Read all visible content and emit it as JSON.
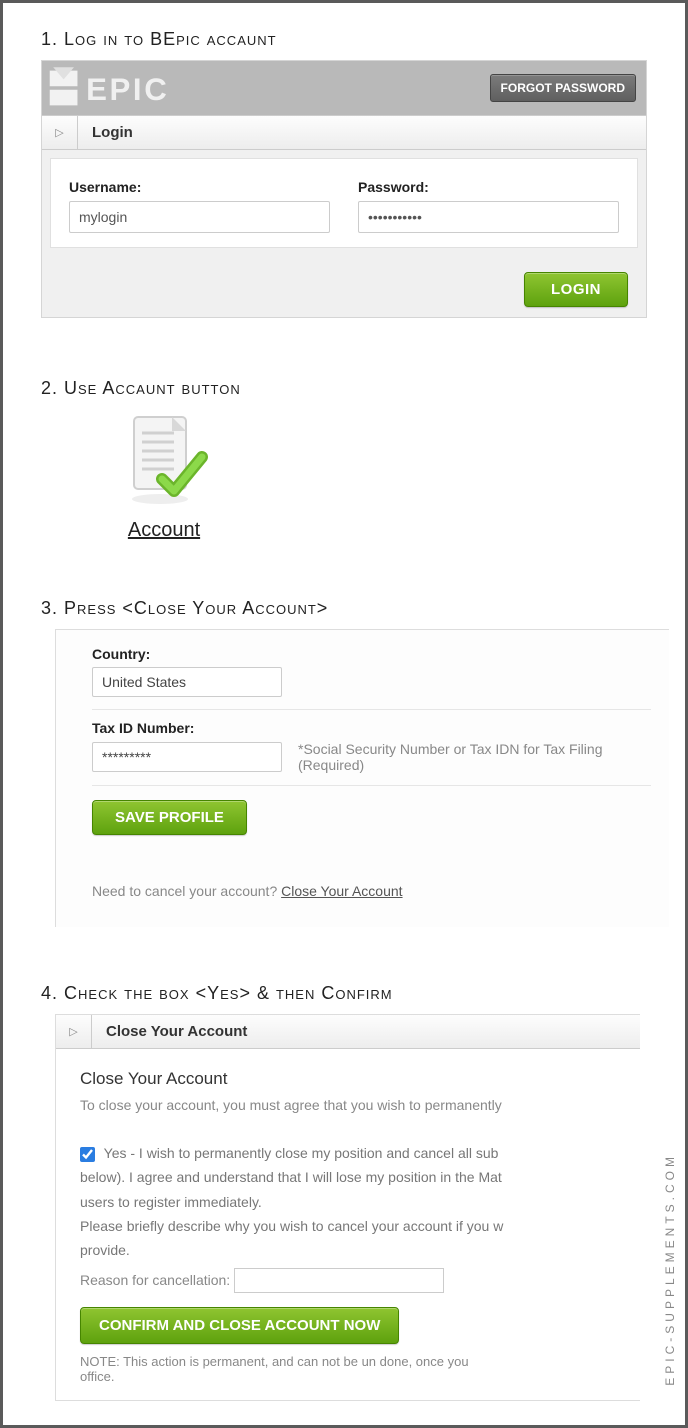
{
  "watermark": "EPIC-SUPPLEMENTS.COM",
  "step1": {
    "title": "1. Log in to BEpic accaunt",
    "forgot": "FORGOT PASSWORD",
    "tab": "Login",
    "username_label": "Username:",
    "username_value": "mylogin",
    "password_label": "Password:",
    "password_value": "•••••••••••",
    "login_btn": "LOGIN"
  },
  "step2": {
    "title": "2. Use Accaunt button",
    "link": "Account"
  },
  "step3": {
    "title": "3. Press <Close Your Account>",
    "country_label": "Country:",
    "country_value": "United States",
    "tax_label": "Tax ID Number:",
    "tax_value": "*********",
    "tax_hint": "*Social Security Number or Tax IDN for Tax Filing (Required)",
    "save_btn": "SAVE PROFILE",
    "cancel_question": "Need to cancel your account? ",
    "cancel_link": "Close Your Account"
  },
  "step4": {
    "title": "4. Check the box <Yes> & then Confirm",
    "tab": "Close Your Account",
    "heading": "Close Your Account",
    "lead": "To close your account, you must agree that you wish to permanently",
    "yes_text": "Yes - I wish to permanently close my position and cancel all sub",
    "yes_line2": "below). I agree and understand that I will lose my position in the Mat",
    "yes_line3": "users to register immediately.",
    "describe": "Please briefly describe why you wish to cancel your account if you w",
    "provide": "provide.",
    "reason_label": "Reason for cancellation:",
    "confirm_btn": "CONFIRM AND CLOSE ACCOUNT NOW",
    "note": "NOTE: This action is permanent, and can not be un done, once you",
    "note2": "office."
  }
}
